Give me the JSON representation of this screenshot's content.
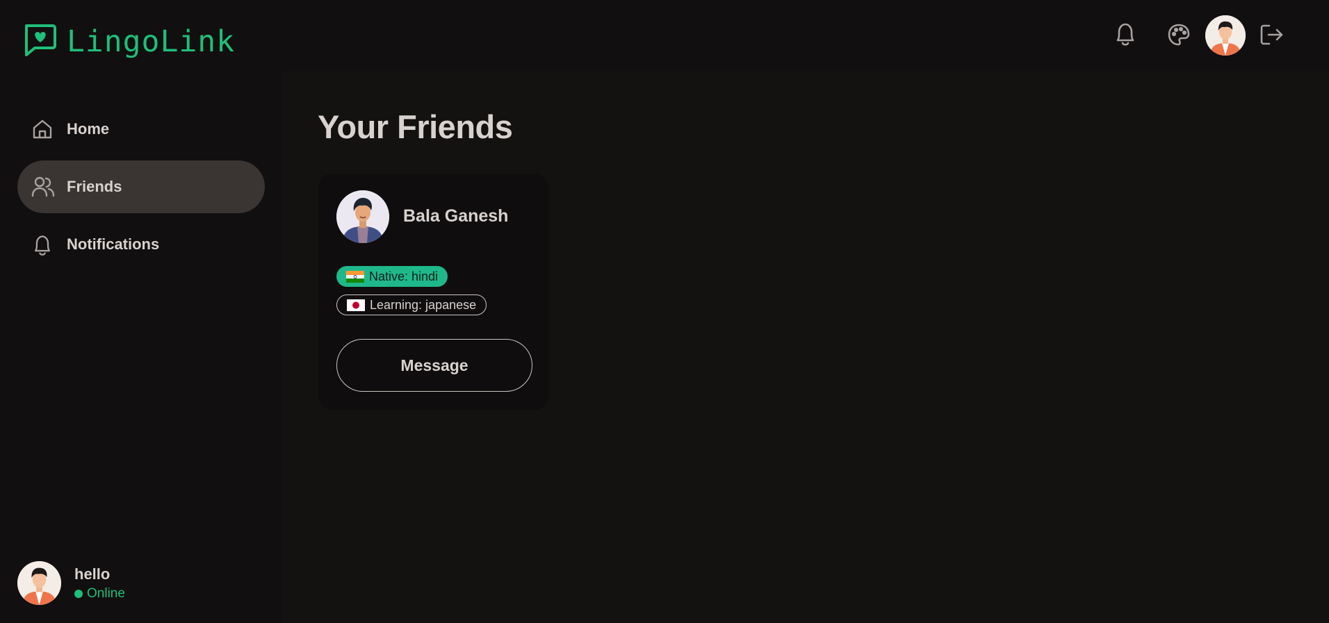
{
  "app": {
    "name": "LingoLink"
  },
  "header": {
    "icons": [
      "bell-icon",
      "palette-icon",
      "user-avatar",
      "logout-icon"
    ]
  },
  "sidebar": {
    "items": [
      {
        "label": "Home",
        "icon": "home-icon",
        "active": false
      },
      {
        "label": "Friends",
        "icon": "users-icon",
        "active": true
      },
      {
        "label": "Notifications",
        "icon": "bell-icon",
        "active": false
      }
    ],
    "user": {
      "name": "hello",
      "status": "Online"
    }
  },
  "main": {
    "title": "Your Friends",
    "friends": [
      {
        "name": "Bala Ganesh",
        "native": "Native: hindi",
        "learning": "Learning: japanese",
        "action": "Message"
      }
    ]
  },
  "colors": {
    "accent": "#1fbf7a",
    "background": "#141111",
    "sidebar": "#110f0f",
    "active_nav": "#3a3533",
    "native_badge": "#1fb88a"
  }
}
